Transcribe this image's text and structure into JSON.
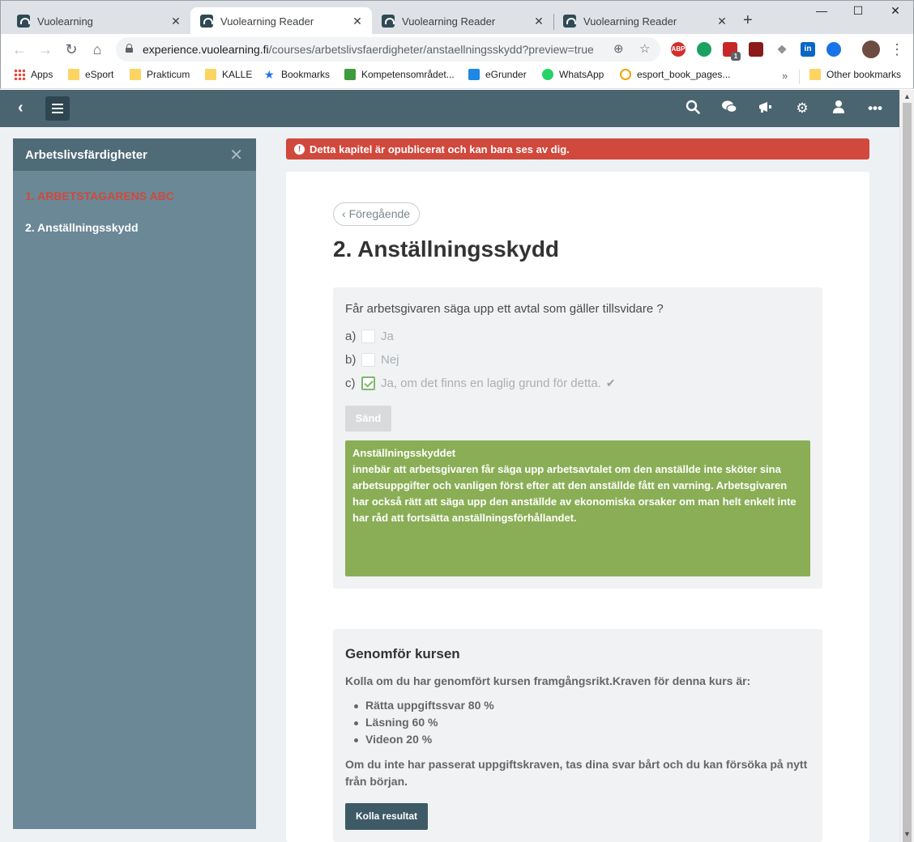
{
  "browser": {
    "tabs": [
      {
        "title": "Vuolearning",
        "active": false
      },
      {
        "title": "Vuolearning Reader",
        "active": true
      },
      {
        "title": "Vuolearning Reader",
        "active": false
      },
      {
        "title": "Vuolearning Reader",
        "active": false
      }
    ],
    "tab_close": "✕",
    "new_tab": "+",
    "window": {
      "minimize": "—",
      "maximize": "☐",
      "close": "✕"
    },
    "url_host": "experience.vuolearning.fi",
    "url_path": "/courses/arbetslivsfaerdigheter/anstaellningsskydd?preview=true",
    "bookmarks": [
      {
        "label": "Apps",
        "icon": "apps-grid-icon"
      },
      {
        "label": "eSport",
        "icon": "folder-icon"
      },
      {
        "label": "Prakticum",
        "icon": "folder-icon"
      },
      {
        "label": "KALLE",
        "icon": "folder-icon"
      },
      {
        "label": "Bookmarks",
        "icon": "star-icon"
      },
      {
        "label": "Kompetensområdet...",
        "icon": "play-icon"
      },
      {
        "label": "eGrunder",
        "icon": "e-icon"
      },
      {
        "label": "WhatsApp",
        "icon": "whatsapp-icon"
      },
      {
        "label": "esport_book_pages...",
        "icon": "p-icon"
      }
    ],
    "bookmarks_more": "»",
    "other_bookmarks": "Other bookmarks",
    "extensions": {
      "abp": "ABP",
      "badge": "1"
    }
  },
  "app": {
    "sidebar": {
      "title": "Arbetslivsfärdigheter",
      "close": "✕",
      "chapters": [
        {
          "label": "1. ARBETSTAGARENS ABC",
          "color": "#d0493c"
        },
        {
          "label": "2. Anställningsskydd",
          "color": "#ffffff"
        }
      ]
    },
    "alert": "Detta kapitel är opublicerat och kan bara ses av dig.",
    "prev_button": "Föregående",
    "page_title": "2. Anställningsskydd",
    "quiz": {
      "question": "Får arbetsgivaren säga upp ett avtal som gäller tillsvidare ?",
      "options": [
        {
          "letter": "a)",
          "text": "Ja",
          "checked": false
        },
        {
          "letter": "b)",
          "text": "Nej",
          "checked": false
        },
        {
          "letter": "c)",
          "text": "Ja, om det finns en laglig grund för detta.",
          "checked": true
        }
      ],
      "send_button": "Sänd",
      "feedback_title": "Anställningsskyddet",
      "feedback_body": "innebär att arbetsgivaren får säga upp arbetsavtalet om den anställde inte sköter sina arbetsuppgifter och vanligen först efter att den anställde fått en varning. Arbetsgivaren har också rätt att säga upp den anställde av ekonomiska orsaker om man helt enkelt inte har råd att fortsätta anställningsförhållandet."
    },
    "complete": {
      "title": "Genomför kursen",
      "intro": "Kolla om du har genomfört kursen framgångsrikt.Kraven för denna kurs är:",
      "requirements": [
        "Rätta uppgiftssvar 80 %",
        "Läsning 60 %",
        "Videon 20 %"
      ],
      "note": "Om du inte har passerat uppgiftskraven, tas dina svar bårt och du kan försöka på nytt från början.",
      "button": "Kolla resultat"
    }
  },
  "colors": {
    "appbar": "#4a6470",
    "sidebar": "#6b8896",
    "alert": "#d0493c",
    "feedback": "#8aae55",
    "button": "#3e5a67"
  }
}
